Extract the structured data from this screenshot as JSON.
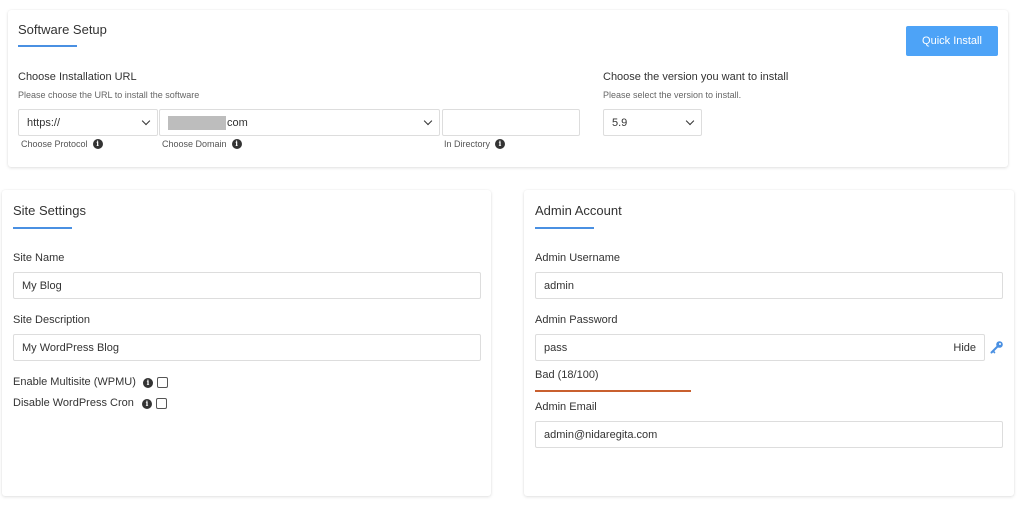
{
  "software_setup": {
    "title": "Software Setup",
    "quick_install_label": "Quick Install",
    "install_url": {
      "label": "Choose Installation URL",
      "sublabel": "Please choose the URL to install the software",
      "protocol_value": "https://",
      "protocol_hint": "Choose Protocol",
      "domain_value": "com",
      "domain_hint": "Choose Domain",
      "directory_value": "",
      "directory_hint": "In Directory"
    },
    "version": {
      "label": "Choose the version you want to install",
      "sublabel": "Please select the version to install.",
      "value": "5.9"
    }
  },
  "site_settings": {
    "title": "Site Settings",
    "site_name_label": "Site Name",
    "site_name_value": "My Blog",
    "site_description_label": "Site Description",
    "site_description_value": "My WordPress Blog",
    "multisite_label": "Enable Multisite (WPMU)",
    "multisite_checked": false,
    "disable_cron_label": "Disable WordPress Cron",
    "disable_cron_checked": false
  },
  "admin_account": {
    "title": "Admin Account",
    "username_label": "Admin Username",
    "username_value": "admin",
    "password_label": "Admin Password",
    "password_value": "pass",
    "hide_label": "Hide",
    "strength_text": "Bad (18/100)",
    "strength_score": 18,
    "email_label": "Admin Email",
    "email_value": "admin@nidaregita.com"
  },
  "colors": {
    "accent": "#4a90e2",
    "button": "#4da3f7",
    "strength_bad": "#c9602f"
  },
  "icons": [
    "info-icon",
    "chevron-down-icon",
    "key-icon"
  ]
}
